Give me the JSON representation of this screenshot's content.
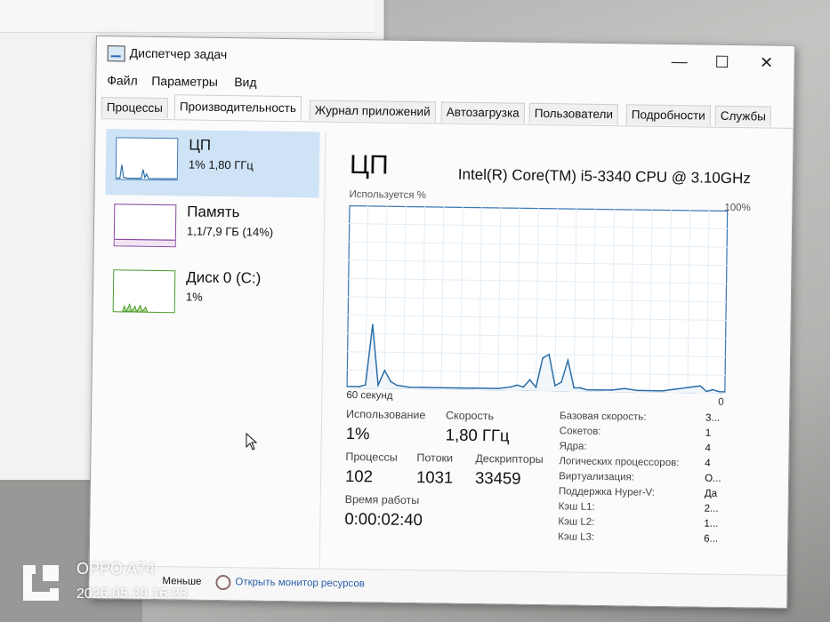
{
  "window": {
    "title": "Диспетчер задач"
  },
  "menu": [
    "Файл",
    "Параметры",
    "Вид"
  ],
  "tabs": [
    {
      "label": "Процессы",
      "active": false
    },
    {
      "label": "Производительность",
      "active": true
    },
    {
      "label": "Журнал приложений",
      "active": false
    },
    {
      "label": "Автозагрузка",
      "active": false
    },
    {
      "label": "Пользователи",
      "active": false
    },
    {
      "label": "Подробности",
      "active": false
    },
    {
      "label": "Службы",
      "active": false
    }
  ],
  "sidebar": [
    {
      "name": "ЦП",
      "value": "1% 1,80 ГГц",
      "selected": true
    },
    {
      "name": "Память",
      "value": "1,1/7,9 ГБ (14%)",
      "selected": false
    },
    {
      "name": "Диск 0 (C:)",
      "value": "1%",
      "selected": false
    }
  ],
  "cpu": {
    "title": "ЦП",
    "model": "Intel(R) Core(TM) i5-3340 CPU @ 3.10GHz",
    "graph_label": "Используется %",
    "graph_max": "100%",
    "graph_xlabel": "60 секунд",
    "graph_min": "0"
  },
  "stats": {
    "usage_label": "Использование",
    "usage_value": "1%",
    "speed_label": "Скорость",
    "speed_value": "1,80 ГГц",
    "processes_label": "Процессы",
    "processes_value": "102",
    "threads_label": "Потоки",
    "threads_value": "1031",
    "handles_label": "Дескрипторы",
    "handles_value": "33459",
    "uptime_label": "Время работы",
    "uptime_value": "0:00:02:40"
  },
  "specs": [
    {
      "label": "Базовая скорость:",
      "value": "3..."
    },
    {
      "label": "Сокетов:",
      "value": "1"
    },
    {
      "label": "Ядра:",
      "value": "4"
    },
    {
      "label": "Логических процессоров:",
      "value": "4"
    },
    {
      "label": "Виртуализация:",
      "value": "О..."
    },
    {
      "label": "Поддержка Hyper-V:",
      "value": "Да"
    },
    {
      "label": "Кэш L1:",
      "value": "2..."
    },
    {
      "label": "Кэш L2:",
      "value": "1..."
    },
    {
      "label": "Кэш L3:",
      "value": "6..."
    }
  ],
  "footer": {
    "less": "Меньше",
    "monitor": "Открыть монитор ресурсов"
  },
  "watermark": {
    "device": "OPPO A74",
    "datetime": "2026.05.29 16:23"
  },
  "colors": {
    "graph_line": "#2b6ea8",
    "graph_border": "#3b78b5",
    "memory": "#8b4aa0",
    "disk": "#4c9a2a",
    "selected": "#cfe3f7"
  },
  "chart_data": {
    "type": "line",
    "title": "Используется %",
    "xlabel": "60 секунд",
    "ylabel": "",
    "ylim": [
      0,
      100
    ],
    "x": [
      60,
      58,
      57,
      56,
      55,
      54,
      53,
      52,
      50,
      48,
      46,
      44,
      42,
      40,
      38,
      36,
      34,
      33,
      32,
      31,
      30,
      29,
      28,
      27,
      26,
      25,
      24,
      23,
      22,
      21,
      20,
      18,
      16,
      14,
      12,
      10,
      8,
      6,
      4,
      3,
      2,
      1,
      0
    ],
    "series": [
      {
        "values": [
          1,
          1,
          2,
          35,
          2,
          10,
          4,
          2,
          1,
          1,
          1,
          1,
          1,
          1,
          1,
          1,
          2,
          3,
          2,
          6,
          2,
          18,
          20,
          3,
          5,
          17,
          2,
          2,
          1,
          1,
          1,
          1,
          2,
          1,
          1,
          1,
          2,
          3,
          4,
          1,
          2,
          1,
          1
        ]
      }
    ]
  }
}
